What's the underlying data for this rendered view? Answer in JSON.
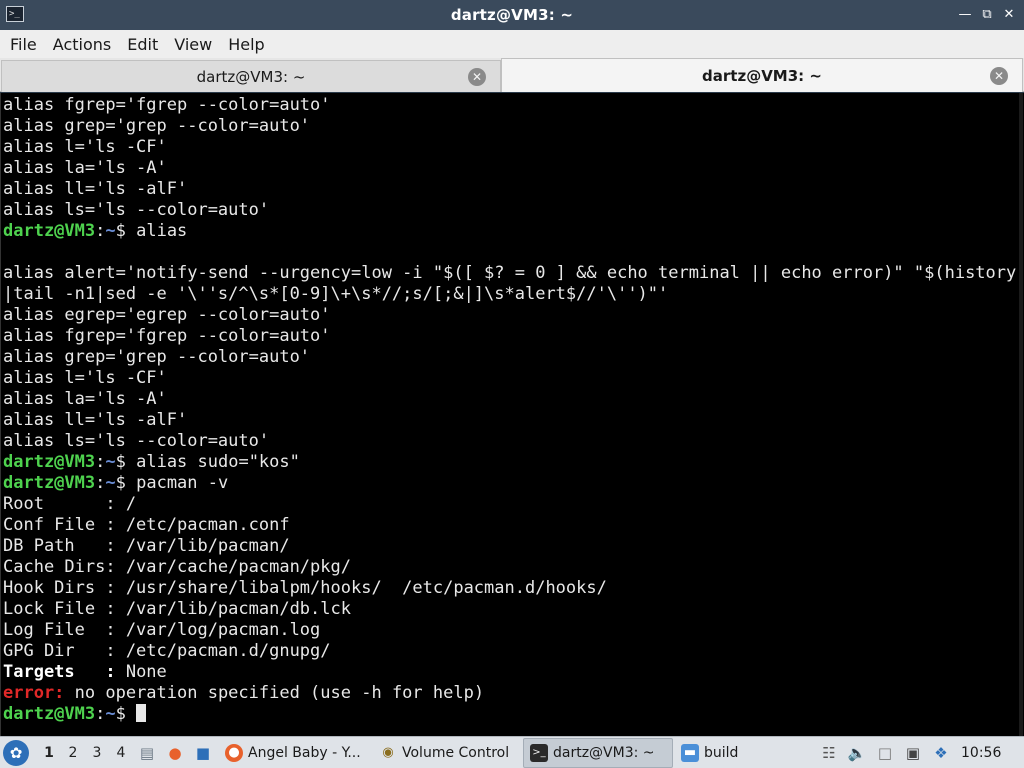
{
  "window": {
    "title": "dartz@VM3: ~"
  },
  "menu": [
    "File",
    "Actions",
    "Edit",
    "View",
    "Help"
  ],
  "tabs": [
    {
      "label": "dartz@VM3: ~",
      "active": false
    },
    {
      "label": "dartz@VM3: ~",
      "active": true
    }
  ],
  "terminal": {
    "prompt_user": "dartz@VM3",
    "prompt_sep": ":",
    "prompt_path": "~",
    "prompt_dollar": "$ ",
    "lines": [
      {
        "type": "text",
        "text": "alias fgrep='fgrep --color=auto'"
      },
      {
        "type": "text",
        "text": "alias grep='grep --color=auto'"
      },
      {
        "type": "text",
        "text": "alias l='ls -CF'"
      },
      {
        "type": "text",
        "text": "alias la='ls -A'"
      },
      {
        "type": "text",
        "text": "alias ll='ls -alF'"
      },
      {
        "type": "text",
        "text": "alias ls='ls --color=auto'"
      },
      {
        "type": "prompt",
        "text": "alias"
      },
      {
        "type": "text",
        "text": ""
      },
      {
        "type": "text",
        "text": "alias alert='notify-send --urgency=low -i \"$([ $? = 0 ] && echo terminal || echo error)\" \"$(history"
      },
      {
        "type": "text",
        "text": "|tail -n1|sed -e '\\''s/^\\s*[0-9]\\+\\s*//;s/[;&|]\\s*alert$//'\\'')\"'"
      },
      {
        "type": "text",
        "text": "alias egrep='egrep --color=auto'"
      },
      {
        "type": "text",
        "text": "alias fgrep='fgrep --color=auto'"
      },
      {
        "type": "text",
        "text": "alias grep='grep --color=auto'"
      },
      {
        "type": "text",
        "text": "alias l='ls -CF'"
      },
      {
        "type": "text",
        "text": "alias la='ls -A'"
      },
      {
        "type": "text",
        "text": "alias ll='ls -alF'"
      },
      {
        "type": "text",
        "text": "alias ls='ls --color=auto'"
      },
      {
        "type": "prompt",
        "text": "alias sudo=\"kos\""
      },
      {
        "type": "prompt",
        "text": "pacman -v"
      },
      {
        "type": "text",
        "text": "Root      : /"
      },
      {
        "type": "text",
        "text": "Conf File : /etc/pacman.conf"
      },
      {
        "type": "text",
        "text": "DB Path   : /var/lib/pacman/"
      },
      {
        "type": "text",
        "text": "Cache Dirs: /var/cache/pacman/pkg/"
      },
      {
        "type": "text",
        "text": "Hook Dirs : /usr/share/libalpm/hooks/  /etc/pacman.d/hooks/"
      },
      {
        "type": "text",
        "text": "Lock File : /var/lib/pacman/db.lck"
      },
      {
        "type": "text",
        "text": "Log File  : /var/log/pacman.log"
      },
      {
        "type": "text",
        "text": "GPG Dir   : /etc/pacman.d/gnupg/"
      },
      {
        "type": "bold",
        "label": "Targets   :",
        "text": " None"
      },
      {
        "type": "error",
        "label": "error:",
        "text": " no operation specified (use -h for help)"
      },
      {
        "type": "prompt",
        "text": "",
        "cursor": true
      }
    ]
  },
  "taskbar": {
    "workspaces": [
      "1",
      "2",
      "3",
      "4"
    ],
    "current_workspace": "1",
    "tasks": [
      {
        "label": "Angel Baby - Y...",
        "icon": "firefox-icon"
      },
      {
        "label": "Volume Control",
        "icon": "volume-control-icon"
      },
      {
        "label": "dartz@VM3: ~",
        "icon": "terminal-icon",
        "active": true
      },
      {
        "label": "build",
        "icon": "folder-icon"
      }
    ],
    "clock": "10:56"
  }
}
